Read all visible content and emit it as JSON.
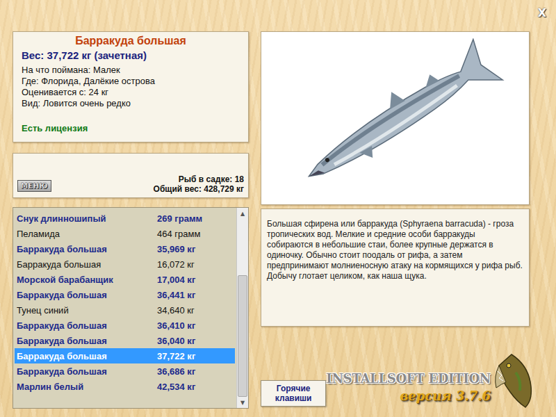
{
  "close_button": "X",
  "fish": {
    "title": "Барракуда большая",
    "weight": "Вес: 37,722 кг (зачетная)",
    "details": [
      "На что поймана: Малек",
      "Где: Флорида, Далёкие острова",
      "Оценивается с: 24 кг",
      "Вид: Ловится очень редко"
    ],
    "license": "Есть лицензия"
  },
  "menu_button": "МЕНЮ",
  "keepnet": {
    "count": "Рыб в садке: 18",
    "total": "Общий вес: 428,729 кг"
  },
  "catch_list": [
    {
      "name": "Снук длинношипый",
      "weight": "269 грамм",
      "trophy": true,
      "selected": false
    },
    {
      "name": "Пеламида",
      "weight": "464 грамм",
      "trophy": false,
      "selected": false
    },
    {
      "name": "Барракуда большая",
      "weight": "35,969 кг",
      "trophy": true,
      "selected": false
    },
    {
      "name": "Барракуда большая",
      "weight": "16,072 кг",
      "trophy": false,
      "selected": false
    },
    {
      "name": "Морской барабанщик",
      "weight": "17,004 кг",
      "trophy": true,
      "selected": false
    },
    {
      "name": "Барракуда большая",
      "weight": "36,441 кг",
      "trophy": true,
      "selected": false
    },
    {
      "name": "Тунец синий",
      "weight": "34,640 кг",
      "trophy": false,
      "selected": false
    },
    {
      "name": "Барракуда большая",
      "weight": "36,410 кг",
      "trophy": true,
      "selected": false
    },
    {
      "name": "Барракуда большая",
      "weight": "36,040 кг",
      "trophy": true,
      "selected": false
    },
    {
      "name": "Барракуда большая",
      "weight": "37,722 кг",
      "trophy": true,
      "selected": true
    },
    {
      "name": "Барракуда большая",
      "weight": "36,686 кг",
      "trophy": true,
      "selected": false
    },
    {
      "name": "Марлин белый",
      "weight": "42,534 кг",
      "trophy": true,
      "selected": false
    }
  ],
  "scrollbar": {
    "up": "▲",
    "down": "▼",
    "level": 1,
    "thumb_share": 0.68
  },
  "description": "Большая сфирена или барракуда (Sphyraena barracuda) - гроза тропических вод. Мелкие и средние особи барракуды собираются в небольшие стаи, более крупные держатся в одиночку. Обычно стоит поодаль от рифа, а затем предпринимают молниеносную атаку на кормящихся у рифа рыб. Добычу глотает целиком, как наша щука.",
  "hotkeys_button": "Горячие клавиши",
  "edition": {
    "title": "INSTALLSOFT EDITION",
    "version": "версия 3.7.6"
  }
}
